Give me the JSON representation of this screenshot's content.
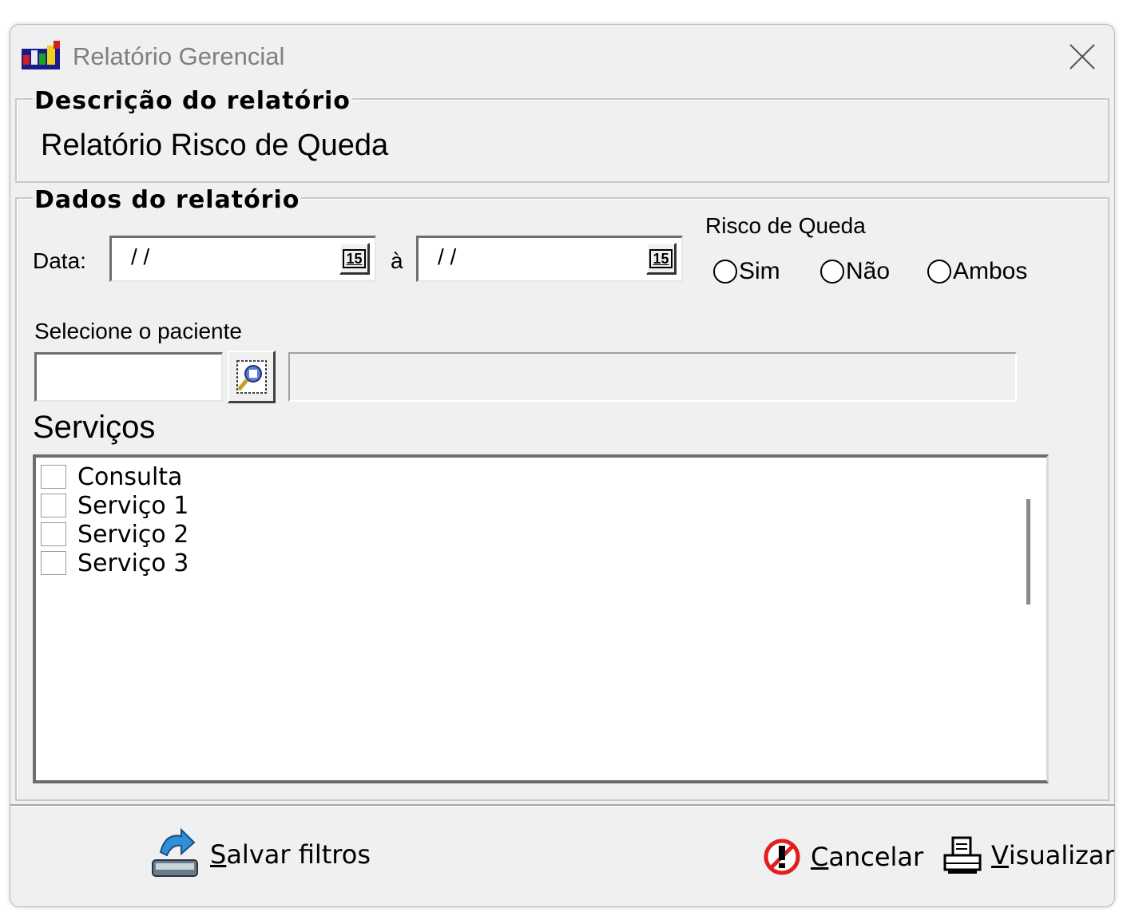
{
  "window": {
    "title": "Relatório Gerencial",
    "close_symbol": "✕",
    "app_icon": "report-app-icon"
  },
  "description": {
    "legend": "Descrição do relatório",
    "value": "Relatório Risco de Queda"
  },
  "data_group": {
    "legend": "Dados do relatório",
    "date_label": "Data:",
    "date_from_value": "/ /",
    "between_label": "à",
    "date_to_value": "/ /",
    "calendar_icon_text": "15",
    "risco_label": "Risco de Queda",
    "risco_options": [
      "Sim",
      "Não",
      "Ambos"
    ],
    "patient_label": "Selecione o paciente",
    "patient_code_value": "",
    "patient_name_value": ""
  },
  "services": {
    "title": "Serviços",
    "items": [
      "Consulta",
      "Serviço 1",
      "Serviço 2",
      "Serviço 3"
    ]
  },
  "footer": {
    "save_label_rest": "alvar filtros",
    "save_label_accel": "S",
    "cancel_label_accel": "C",
    "cancel_label_rest": "ancelar",
    "view_label_accel": "V",
    "view_label_rest": "isualizar"
  },
  "colors": {
    "window_bg": "#f0f0f0",
    "title_text": "#7f7f7f",
    "cancel_icon": "#e02020"
  }
}
